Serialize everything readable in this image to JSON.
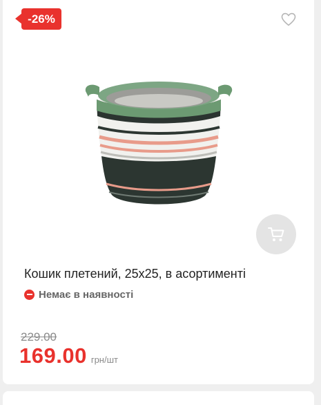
{
  "badge": {
    "discount": "-26%"
  },
  "product": {
    "title": "Кошик плетений, 25x25, в асортименті",
    "stock_status": "Немає в наявності",
    "old_price": "229.00",
    "price": "169.00",
    "price_unit": "грн/шт"
  },
  "colors": {
    "accent": "#e9322d",
    "cart_button_bg": "#e4e4e4",
    "muted_text": "#8a8a8a"
  },
  "icons": {
    "favorite": "heart-outline-icon",
    "cart": "cart-icon",
    "stock": "minus-circle-icon"
  }
}
